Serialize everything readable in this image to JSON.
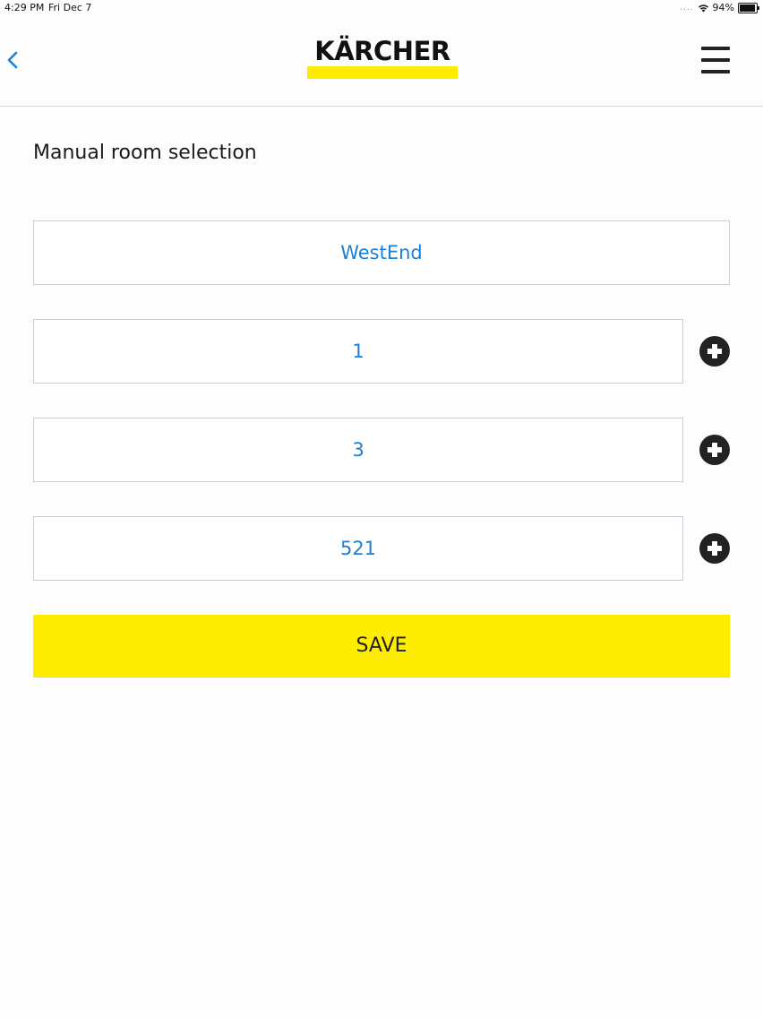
{
  "status_bar": {
    "time": "4:29 PM",
    "date": "Fri Dec 7",
    "signal": "....",
    "battery_percent": "94%",
    "battery_level": 0.94
  },
  "header": {
    "logo_text": "KÄRCHER",
    "brand_color": "#ffed00",
    "back_icon": "chevron-left-icon",
    "menu_icon": "hamburger-menu-icon"
  },
  "main": {
    "title": "Manual room selection",
    "building_field": {
      "value": "WestEnd"
    },
    "level_fields": [
      {
        "value": "1"
      },
      {
        "value": "3"
      },
      {
        "value": "521"
      }
    ],
    "add_icon": "plus-circle-icon",
    "save_label": "SAVE",
    "value_color": "#1b7fd6"
  }
}
